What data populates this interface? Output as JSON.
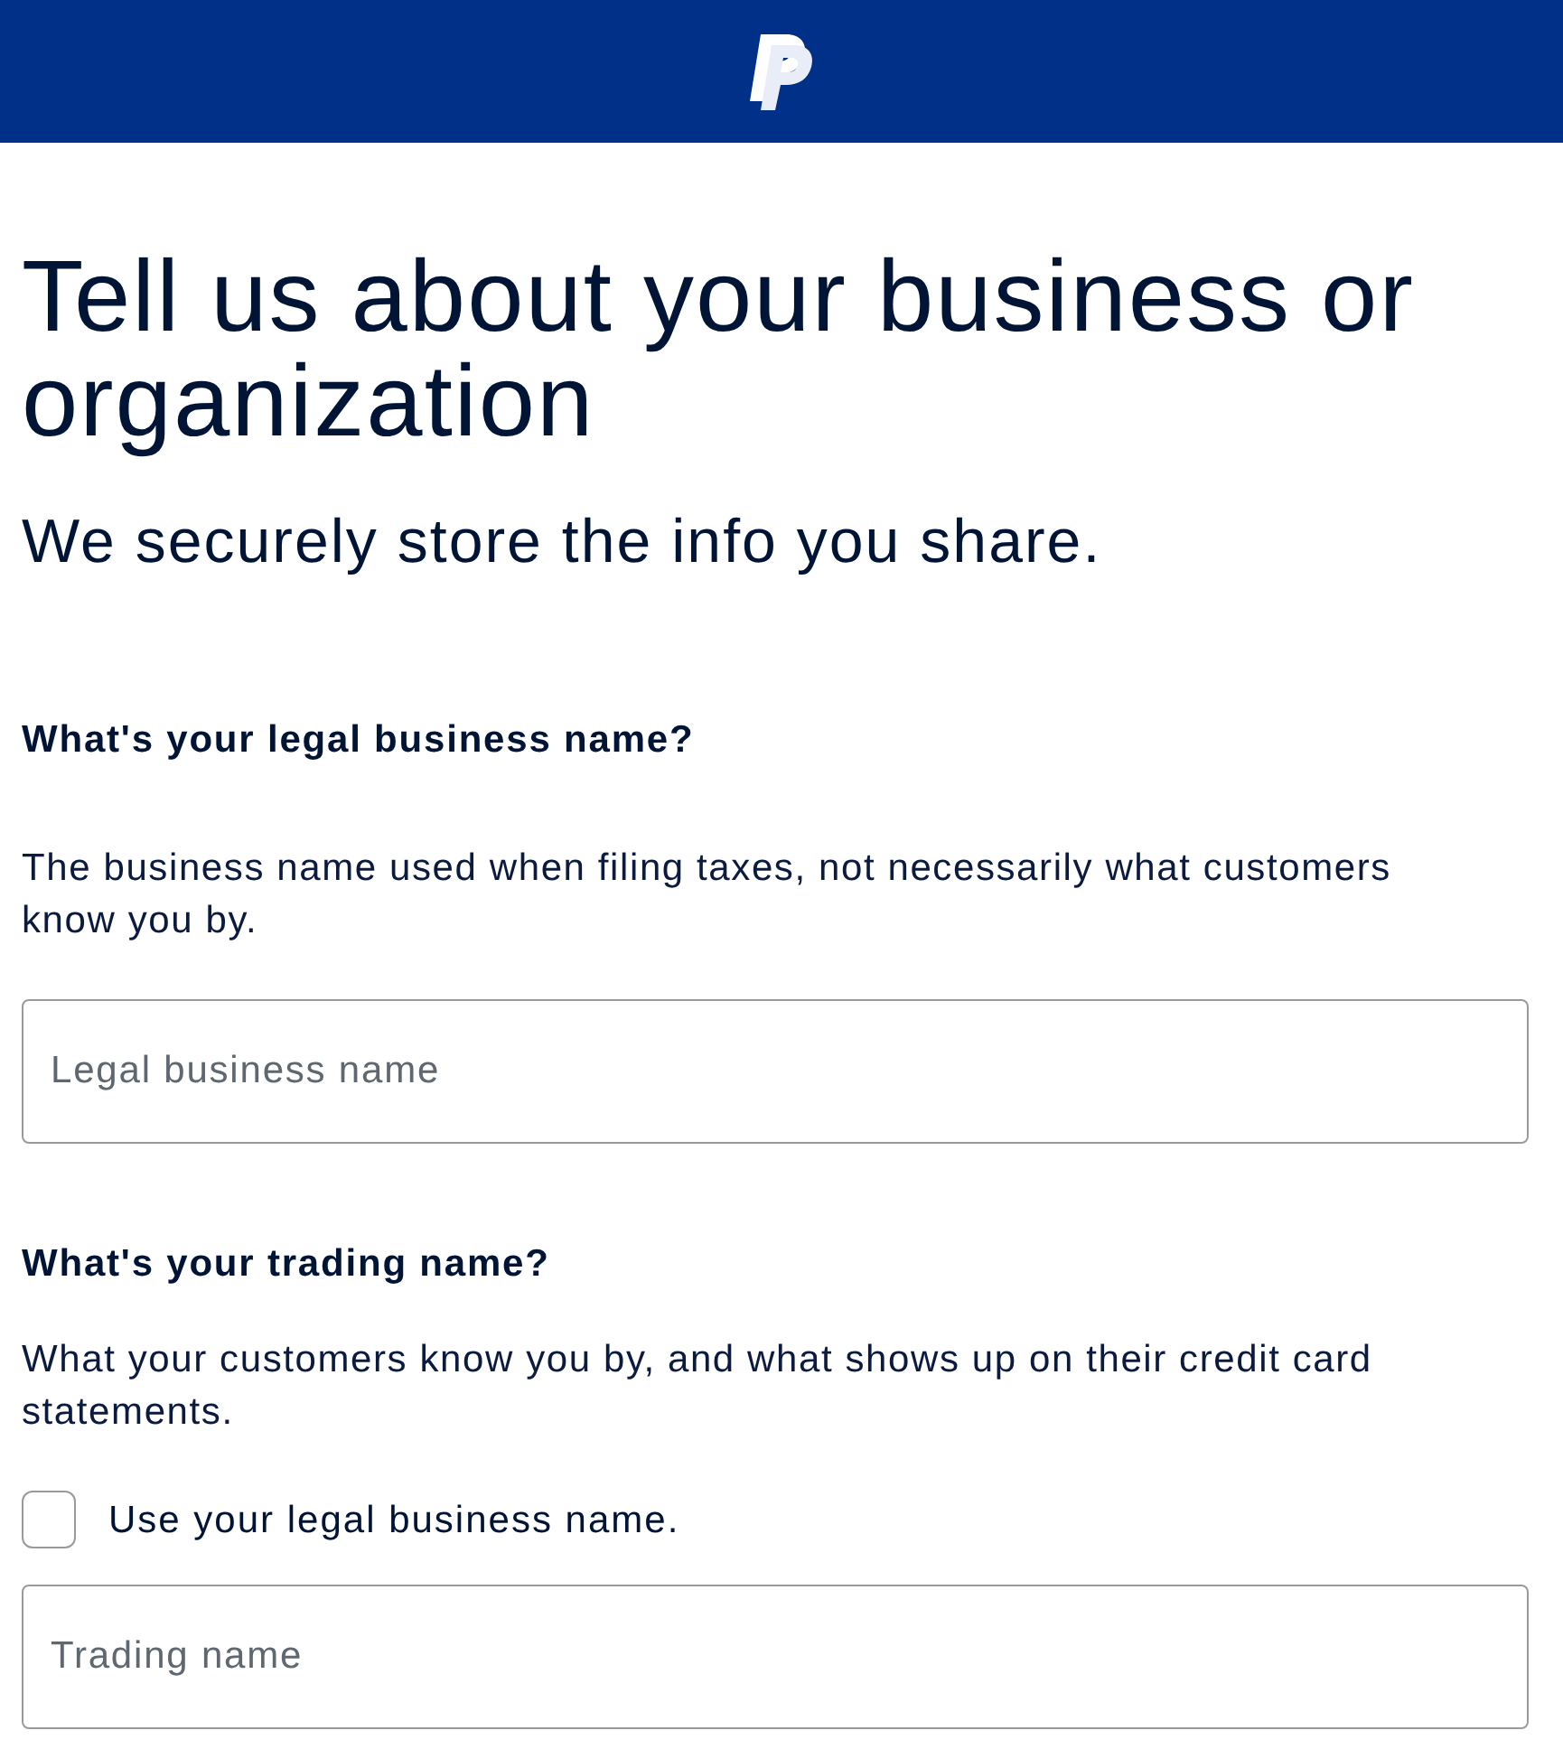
{
  "heading": "Tell us about your business or organization",
  "subheading": "We securely store the info you share.",
  "questions": [
    {
      "label": "What's your legal business name?",
      "description": "The business name used when filing taxes, not necessarily what customers know you by.",
      "placeholder": "Legal business name"
    },
    {
      "label": "What's your trading name?",
      "description": "What your customers know you by, and what shows up on their credit card statements.",
      "checkbox": {
        "label": "Use your legal business name.",
        "checked": false
      },
      "placeholder": "Trading name"
    }
  ]
}
